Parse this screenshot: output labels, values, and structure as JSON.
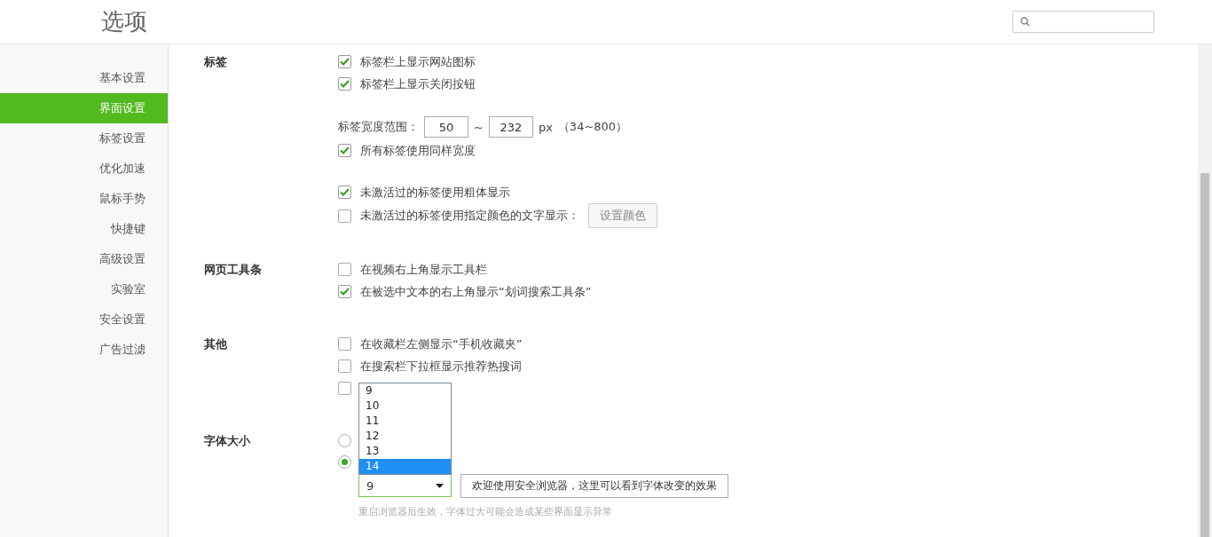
{
  "title": "选项",
  "sidebar": {
    "items": [
      {
        "label": "基本设置",
        "selected": false
      },
      {
        "label": "界面设置",
        "selected": true
      },
      {
        "label": "标签设置",
        "selected": false
      },
      {
        "label": "优化加速",
        "selected": false
      },
      {
        "label": "鼠标手势",
        "selected": false
      },
      {
        "label": "快捷键",
        "selected": false
      },
      {
        "label": "高级设置",
        "selected": false
      },
      {
        "label": "实验室",
        "selected": false
      },
      {
        "label": "安全设置",
        "selected": false
      },
      {
        "label": "广告过滤",
        "selected": false
      }
    ]
  },
  "sections": [
    {
      "label": "标签",
      "items": [
        {
          "kind": "checkbox",
          "label": "标签栏上显示网站图标",
          "checked": true
        },
        {
          "kind": "checkbox",
          "label": "标签栏上显示关闭按钮",
          "checked": true
        },
        {
          "kind": "spacer"
        },
        {
          "kind": "range",
          "label": "标签宽度范围：",
          "min": "50",
          "separator": "~",
          "max": "232",
          "unit": "px",
          "hint": "（34~800）"
        },
        {
          "kind": "checkbox",
          "label": "所有标签使用同样宽度",
          "checked": true
        },
        {
          "kind": "spacer"
        },
        {
          "kind": "checkbox",
          "label": "未激活过的标签使用粗体显示",
          "checked": true
        },
        {
          "kind": "checkbox",
          "label": "未激活过的标签使用指定颜色的文字显示：",
          "checked": false,
          "button": "设置颜色"
        }
      ]
    },
    {
      "label": "网页工具条",
      "items": [
        {
          "kind": "checkbox",
          "label": "在视频右上角显示工具栏",
          "checked": false
        },
        {
          "kind": "checkbox",
          "label": "在被选中文本的右上角显示“划词搜索工具条”",
          "checked": true
        }
      ]
    },
    {
      "label": "其他",
      "items": [
        {
          "kind": "checkbox",
          "label": "在收藏栏左侧显示“手机收藏夹”",
          "checked": false
        },
        {
          "kind": "checkbox",
          "label": "在搜索栏下拉框显示推荐热搜词",
          "checked": false
        },
        {
          "kind": "checkbox",
          "checked": false
        }
      ]
    },
    {
      "label": "字体大小",
      "items": [
        {
          "kind": "radio",
          "selected": false
        },
        {
          "kind": "radio",
          "selected": true
        },
        {
          "kind": "select",
          "value": "9",
          "preview": "欢迎使用安全浏览器，这里可以看到字体改变的效果",
          "options": [
            {
              "label": "9",
              "highlighted": false
            },
            {
              "label": "10",
              "highlighted": false
            },
            {
              "label": "11",
              "highlighted": false
            },
            {
              "label": "12",
              "highlighted": false
            },
            {
              "label": "13",
              "highlighted": false
            },
            {
              "label": "14",
              "highlighted": true
            }
          ]
        },
        {
          "kind": "hint",
          "text": "重启浏览器后生效，字体过大可能会造成某些界面显示异常"
        }
      ]
    }
  ]
}
